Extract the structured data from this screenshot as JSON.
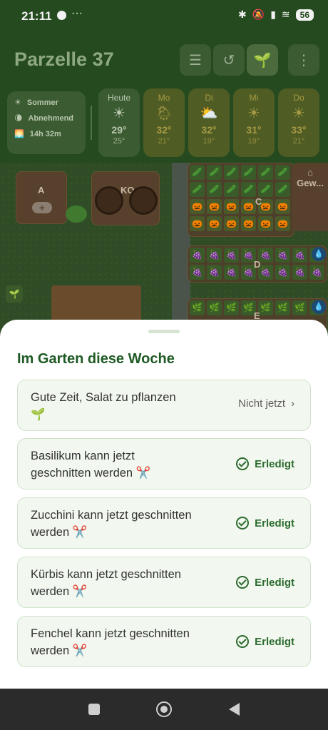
{
  "status": {
    "time": "21:11",
    "dots": "···",
    "battery": "56"
  },
  "header": {
    "title": "Parzelle 37"
  },
  "season": {
    "name": "Sommer",
    "moon": "Abnehmend",
    "daylight": "14h 32m"
  },
  "forecast": [
    {
      "day": "Heute",
      "icon": "☀",
      "hi": "29°",
      "lo": "25°"
    },
    {
      "day": "Mo",
      "icon": "🌦",
      "hi": "32°",
      "lo": "21°"
    },
    {
      "day": "Di",
      "icon": "⛅",
      "hi": "32°",
      "lo": "19°"
    },
    {
      "day": "Mi",
      "icon": "☀",
      "hi": "31°",
      "lo": "19°"
    },
    {
      "day": "Do",
      "icon": "☀",
      "hi": "33°",
      "lo": "21°"
    }
  ],
  "garden": {
    "bed_a": "A",
    "bed_ko": "KO",
    "bed_c": "C",
    "bed_d": "D",
    "bed_e": "E",
    "greenhouse": "Gew..."
  },
  "sheet": {
    "title": "Im Garten diese Woche",
    "tasks": [
      {
        "text_line1": "Gute Zeit, Salat zu pflanzen",
        "text_line2": "🌱",
        "action": "Nicht jetzt"
      },
      {
        "text_line1": "Basilikum kann jetzt",
        "text_line2": "geschnitten werden ✂️",
        "action": "Erledigt"
      },
      {
        "text_line1": "Zucchini kann jetzt geschnitten",
        "text_line2": "werden ✂️",
        "action": "Erledigt"
      },
      {
        "text_line1": "Kürbis kann jetzt geschnitten",
        "text_line2": "werden ✂️",
        "action": "Erledigt"
      },
      {
        "text_line1": "Fenchel kann jetzt geschnitten",
        "text_line2": "werden ✂️",
        "action": "Erledigt"
      }
    ]
  }
}
